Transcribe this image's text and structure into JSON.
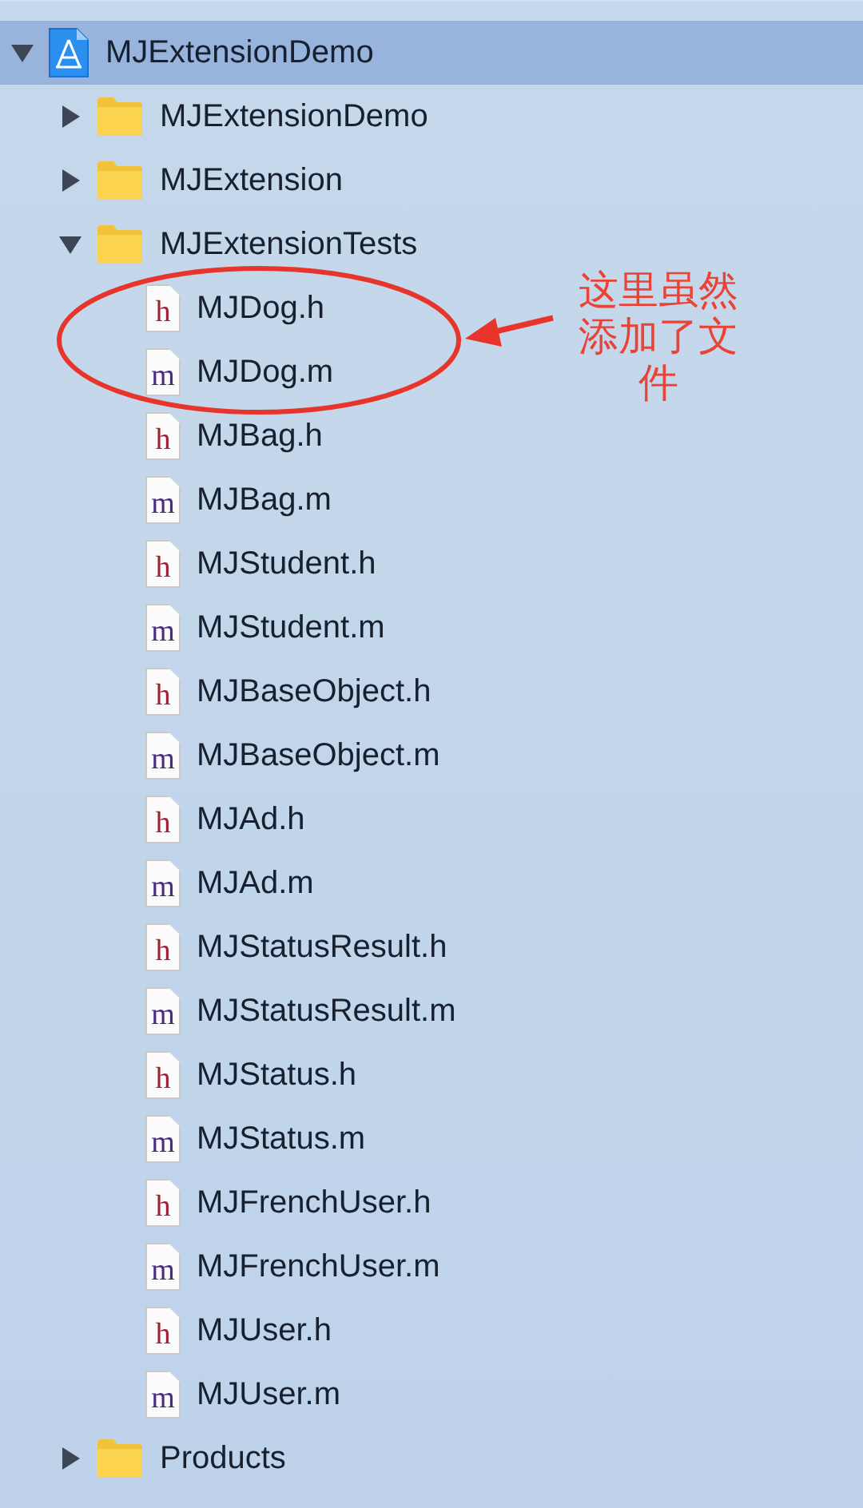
{
  "navigator": {
    "root": {
      "kind": "project",
      "label": "MJExtensionDemo",
      "expanded": true,
      "selected": true,
      "children": [
        {
          "kind": "folder",
          "label": "MJExtensionDemo",
          "expanded": false,
          "selected": false
        },
        {
          "kind": "folder",
          "label": "MJExtension",
          "expanded": false,
          "selected": false
        },
        {
          "kind": "folder",
          "label": "MJExtensionTests",
          "expanded": true,
          "selected": false,
          "children": [
            {
              "kind": "file",
              "badge": "h",
              "label": "MJDog.h",
              "selected": false
            },
            {
              "kind": "file",
              "badge": "m",
              "label": "MJDog.m",
              "selected": false
            },
            {
              "kind": "file",
              "badge": "h",
              "label": "MJBag.h",
              "selected": false
            },
            {
              "kind": "file",
              "badge": "m",
              "label": "MJBag.m",
              "selected": false
            },
            {
              "kind": "file",
              "badge": "h",
              "label": "MJStudent.h",
              "selected": false
            },
            {
              "kind": "file",
              "badge": "m",
              "label": "MJStudent.m",
              "selected": false
            },
            {
              "kind": "file",
              "badge": "h",
              "label": "MJBaseObject.h",
              "selected": false
            },
            {
              "kind": "file",
              "badge": "m",
              "label": "MJBaseObject.m",
              "selected": false
            },
            {
              "kind": "file",
              "badge": "h",
              "label": "MJAd.h",
              "selected": false
            },
            {
              "kind": "file",
              "badge": "m",
              "label": "MJAd.m",
              "selected": false
            },
            {
              "kind": "file",
              "badge": "h",
              "label": "MJStatusResult.h",
              "selected": false
            },
            {
              "kind": "file",
              "badge": "m",
              "label": "MJStatusResult.m",
              "selected": false
            },
            {
              "kind": "file",
              "badge": "h",
              "label": "MJStatus.h",
              "selected": false
            },
            {
              "kind": "file",
              "badge": "m",
              "label": "MJStatus.m",
              "selected": false
            },
            {
              "kind": "file",
              "badge": "h",
              "label": "MJFrenchUser.h",
              "selected": false
            },
            {
              "kind": "file",
              "badge": "m",
              "label": "MJFrenchUser.m",
              "selected": false
            },
            {
              "kind": "file",
              "badge": "h",
              "label": "MJUser.h",
              "selected": false
            },
            {
              "kind": "file",
              "badge": "m",
              "label": "MJUser.m",
              "selected": false
            }
          ]
        },
        {
          "kind": "folder",
          "label": "Products",
          "expanded": false,
          "selected": false
        }
      ]
    }
  },
  "annotation": {
    "note": "这里虽然添加了文件"
  }
}
